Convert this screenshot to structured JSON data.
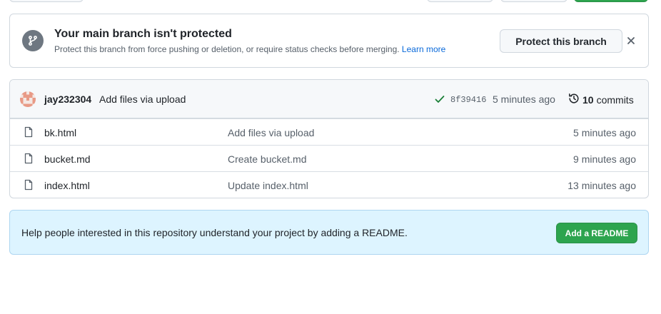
{
  "protect_banner": {
    "title": "Your main branch isn't protected",
    "description": "Protect this branch from force pushing or deletion, or require status checks before merging.",
    "learn_more": "Learn more",
    "button": "Protect this branch",
    "icon": "git-branch-icon"
  },
  "latest_commit": {
    "author": "jay232304",
    "message": "Add files via upload",
    "sha": "8f39416",
    "time": "5 minutes ago",
    "commit_count": "10",
    "commits_label": "commits"
  },
  "files": [
    {
      "name": "bk.html",
      "commit": "Add files via upload",
      "time": "5 minutes ago"
    },
    {
      "name": "bucket.md",
      "commit": "Create bucket.md",
      "time": "9 minutes ago"
    },
    {
      "name": "index.html",
      "commit": "Update index.html",
      "time": "13 minutes ago"
    }
  ],
  "readme_banner": {
    "text": "Help people interested in this repository understand your project by adding a README.",
    "button": "Add a README"
  },
  "colors": {
    "accent_link": "#0969da",
    "success_green": "#2da44e",
    "check_green": "#1a7f37",
    "readme_bg": "#ddf4ff"
  }
}
